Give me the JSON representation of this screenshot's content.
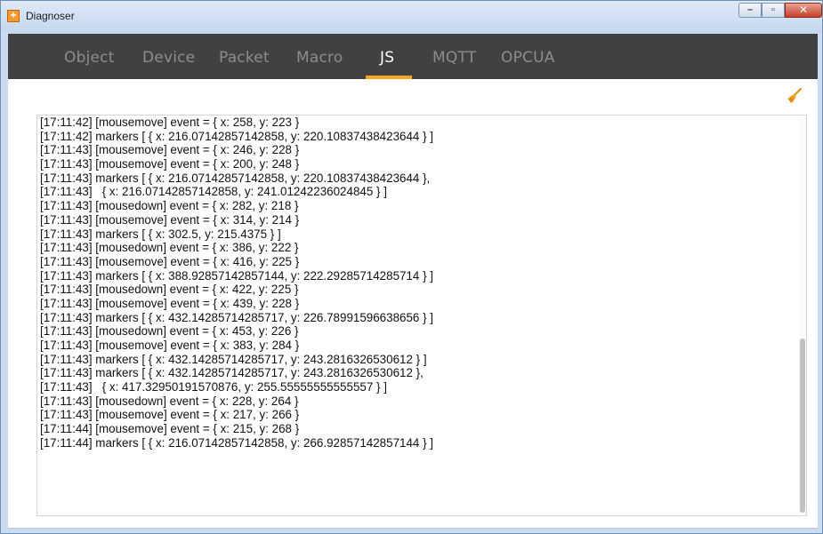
{
  "window": {
    "title": "Diagnoser",
    "app_icon_glyph": "+",
    "minimize_glyph": "–",
    "maximize_glyph": "▫",
    "close_glyph": "✕"
  },
  "tabs": [
    {
      "label": "Object",
      "active": false
    },
    {
      "label": "Device",
      "active": false
    },
    {
      "label": "Packet",
      "active": false
    },
    {
      "label": "Macro",
      "active": false
    },
    {
      "label": "JS",
      "active": true
    },
    {
      "label": "MQTT",
      "active": false
    },
    {
      "label": "OPCUA",
      "active": false
    }
  ],
  "toolbar": {
    "clear_icon": "broom-clear-icon"
  },
  "colors": {
    "tab_bg": "#414141",
    "accent": "#f5a623",
    "tab_inactive": "#8c8c8c",
    "tab_active": "#ffffff"
  },
  "log": {
    "lines": [
      "[17:11:42] [mousemove] event = { x: 258, y: 223 }",
      "[17:11:42] markers [ { x: 216.07142857142858, y: 220.10837438423644 } ]",
      "[17:11:43] [mousemove] event = { x: 246, y: 228 }",
      "[17:11:43] [mousemove] event = { x: 200, y: 248 }",
      "[17:11:43] markers [ { x: 216.07142857142858, y: 220.10837438423644 },",
      "[17:11:43]   { x: 216.07142857142858, y: 241.01242236024845 } ]",
      "[17:11:43] [mousedown] event = { x: 282, y: 218 }",
      "[17:11:43] [mousemove] event = { x: 314, y: 214 }",
      "[17:11:43] markers [ { x: 302.5, y: 215.4375 } ]",
      "[17:11:43] [mousedown] event = { x: 386, y: 222 }",
      "[17:11:43] [mousemove] event = { x: 416, y: 225 }",
      "[17:11:43] markers [ { x: 388.92857142857144, y: 222.29285714285714 } ]",
      "[17:11:43] [mousedown] event = { x: 422, y: 225 }",
      "[17:11:43] [mousemove] event = { x: 439, y: 228 }",
      "[17:11:43] markers [ { x: 432.14285714285717, y: 226.78991596638656 } ]",
      "[17:11:43] [mousedown] event = { x: 453, y: 226 }",
      "[17:11:43] [mousemove] event = { x: 383, y: 284 }",
      "[17:11:43] markers [ { x: 432.14285714285717, y: 243.2816326530612 } ]",
      "[17:11:43] markers [ { x: 432.14285714285717, y: 243.2816326530612 },",
      "[17:11:43]   { x: 417.32950191570876, y: 255.55555555555557 } ]",
      "[17:11:43] [mousedown] event = { x: 228, y: 264 }",
      "[17:11:43] [mousemove] event = { x: 217, y: 266 }",
      "[17:11:44] [mousemove] event = { x: 215, y: 268 }",
      "[17:11:44] markers [ { x: 216.07142857142858, y: 266.92857142857144 } ]"
    ]
  }
}
